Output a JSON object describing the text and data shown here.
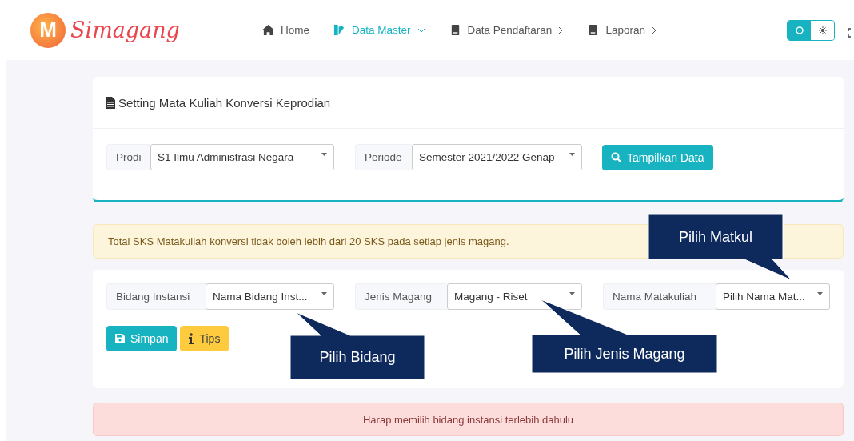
{
  "brand": {
    "name": "Simagang",
    "mark": "M"
  },
  "nav": [
    {
      "label": "Home",
      "selected": false
    },
    {
      "label": "Data Master",
      "selected": true
    },
    {
      "label": "Data Pendaftaran",
      "selected": false
    },
    {
      "label": "Laporan",
      "selected": false
    }
  ],
  "theme_toggle": {
    "dark_selected": true
  },
  "card": {
    "title": "Setting Mata Kuliah Konversi Keprodian",
    "filters": [
      {
        "label": "Prodi",
        "value": "S1 Ilmu Administrasi Negara"
      },
      {
        "label": "Periode",
        "value": "Semester 2021/2022 Genap"
      }
    ],
    "button": "Tampilkan Data"
  },
  "warning": "Total SKS Matakuliah konversi tidak boleh lebih dari 20 SKS pada setiap jenis magang.",
  "form": {
    "fields": [
      {
        "label": "Bidang Instansi",
        "value": "Nama Bidang Inst..."
      },
      {
        "label": "Jenis Magang",
        "value": "Magang - Riset"
      },
      {
        "label": "Nama Matakuliah",
        "value": "Pilih Nama Mat..."
      }
    ],
    "buttons": [
      {
        "label": "Simpan",
        "kind": "save"
      },
      {
        "label": "Tips",
        "kind": "info"
      }
    ]
  },
  "error": "Harap memilih bidang instansi terlebih dahulu",
  "callouts": [
    {
      "text": "Pilih Matkul"
    },
    {
      "text": "Pilih Bidang"
    },
    {
      "text": "Pilih Jenis Magang"
    }
  ]
}
